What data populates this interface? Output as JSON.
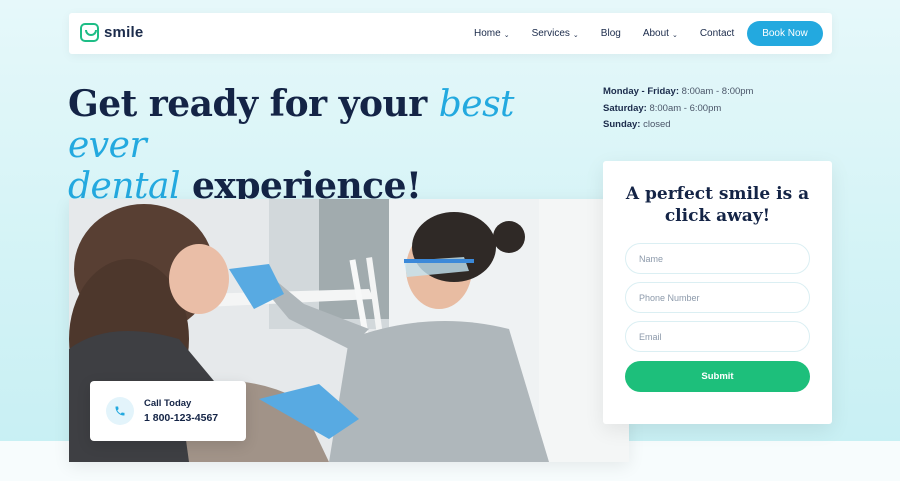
{
  "brand": {
    "name": "smile",
    "color": "#1ebd86"
  },
  "nav": {
    "items": [
      {
        "label": "Home",
        "dropdown": true
      },
      {
        "label": "Services",
        "dropdown": true
      },
      {
        "label": "Blog",
        "dropdown": false
      },
      {
        "label": "About",
        "dropdown": true
      },
      {
        "label": "Contact",
        "dropdown": false
      }
    ],
    "cta_label": "Book Now",
    "cta_color": "#23a9df"
  },
  "hero": {
    "headline_part1": "Get ready for your ",
    "headline_accent1": "best ever",
    "headline_accent2": "dental",
    "headline_part2": " experience!",
    "accent_color": "#23a9df"
  },
  "hours": {
    "weekdays_label": "Monday - Friday:",
    "weekdays_time": "8:00am - 8:00pm",
    "saturday_label": "Saturday:",
    "saturday_time": "8:00am - 6:00pm",
    "sunday_label": "Sunday:",
    "sunday_time": "closed"
  },
  "call": {
    "label": "Call Today",
    "number": "1 800-123-4567",
    "icon": "phone-icon"
  },
  "form": {
    "title": "A perfect smile is a click away!",
    "name_placeholder": "Name",
    "phone_placeholder": "Phone Number",
    "email_placeholder": "Email",
    "submit_label": "Submit",
    "submit_color": "#1dbf7b"
  }
}
